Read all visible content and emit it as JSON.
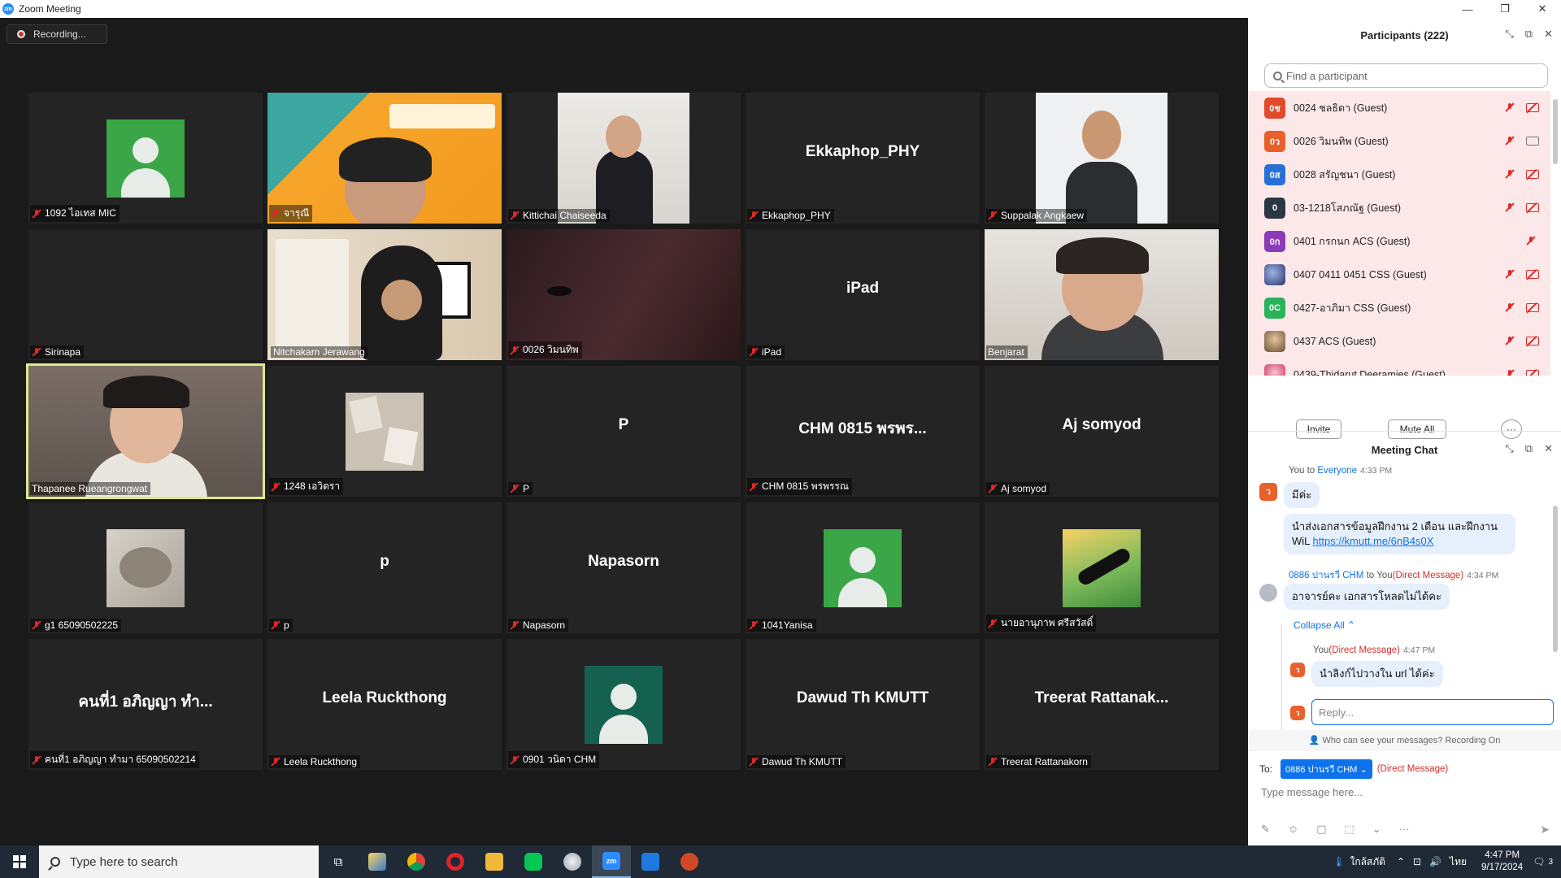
{
  "window": {
    "title": "Zoom Meeting",
    "controls": [
      "—",
      "❐",
      "✕"
    ]
  },
  "recording": {
    "label": "Recording..."
  },
  "tiles": [
    {
      "label": "1092 ไอเทส MIC",
      "big": ""
    },
    {
      "label": "จารุณี",
      "big": ""
    },
    {
      "label": "Kittichai Chaiseeda",
      "big": ""
    },
    {
      "label": "Ekkaphop_PHY",
      "big": "Ekkaphop_PHY"
    },
    {
      "label": "Suppalak Angkaew",
      "big": ""
    },
    {
      "label": "Sirinapa",
      "big": ""
    },
    {
      "label": "Nitchakarn Jerawang",
      "big": ""
    },
    {
      "label": "0026 วิมนทิพ",
      "big": ""
    },
    {
      "label": "iPad",
      "big": "iPad"
    },
    {
      "label": "Benjarat",
      "big": ""
    },
    {
      "label": "Thapanee Rueangrongwat",
      "big": ""
    },
    {
      "label": "1248 เอวิตรา",
      "big": ""
    },
    {
      "label": "P",
      "big": "P"
    },
    {
      "label": "CHM 0815 พรพรรณ",
      "big": "CHM 0815 พรพร..."
    },
    {
      "label": "Aj somyod",
      "big": "Aj somyod"
    },
    {
      "label": "g1 65090502225",
      "big": ""
    },
    {
      "label": "p",
      "big": "p"
    },
    {
      "label": "Napasorn",
      "big": "Napasorn"
    },
    {
      "label": "1041Yanisa",
      "big": ""
    },
    {
      "label": "นายอานุภาพ ศรีสวัสดิ์",
      "big": ""
    },
    {
      "label": "คนที่1 อภิญญา ทำมา 65090502214",
      "big": "คนที่1 อภิญญา ทำ..."
    },
    {
      "label": "Leela Ruckthong",
      "big": "Leela Ruckthong"
    },
    {
      "label": "0901 วนิดา CHM",
      "big": ""
    },
    {
      "label": "Dawud Th KMUTT",
      "big": "Dawud Th KMUTT"
    },
    {
      "label": "Treerat Rattanakorn",
      "big": "Treerat Rattanak..."
    }
  ],
  "participants": {
    "title": "Participants (222)",
    "search_placeholder": "Find a participant",
    "list": [
      {
        "initials": "0ช",
        "name": "0024 ชลธิดา (Guest)",
        "color": "#e0492a"
      },
      {
        "initials": "0ว",
        "name": "0026 วิมนทิพ (Guest)",
        "color": "#e8602c"
      },
      {
        "initials": "0ส",
        "name": "0028 สรัญชนา (Guest)",
        "color": "#2a6fd6"
      },
      {
        "initials": "0",
        "name": "03-1218โสภณัฐ (Guest)",
        "color": "#2b3645"
      },
      {
        "initials": "0ก",
        "name": "0401 กรกนก ACS (Guest)",
        "color": "#8a3bb5"
      },
      {
        "initials": "",
        "name": "0407 0411 0451 CSS (Guest)",
        "color": "#3b4a8f"
      },
      {
        "initials": "0C",
        "name": "0427-อาภิมา CSS (Guest)",
        "color": "#2bb35c"
      },
      {
        "initials": "",
        "name": "0437 ACS (Guest)",
        "color": "#b58a5a"
      },
      {
        "initials": "",
        "name": "0439-Thidarut Deeramies (Guest)",
        "color": "#e0356a"
      }
    ],
    "invite": "Invite",
    "mute_all": "Mute All",
    "more": "···"
  },
  "chat": {
    "title": "Meeting Chat",
    "m1_from": "You to ",
    "m1_to": "Everyone",
    "m1_time": "4:33 PM",
    "m1_avatar": "ว",
    "m1_text": "มีค่ะ",
    "m2_text": "นำส่งเอกสารข้อมูลฝึกงาน 2 เดือน และฝึกงาน WiL ",
    "m2_link": "https://kmutt.me/6nB4s0X",
    "m3_from": "0886 ปานรวี CHM",
    "m3_mid": " to You",
    "m3_dm": "(Direct Message)",
    "m3_time": "4:34 PM",
    "m3_text": "อาจารย์คะ เอกสารโหลดไม่ได้คะ",
    "collapse": "Collapse All",
    "m4_from": "You",
    "m4_dm": "(Direct Message)",
    "m4_time": "4:47 PM",
    "m4_text": "นำลิงก์ไปวางใน url ได้ค่ะ",
    "reply_placeholder": "Reply...",
    "who_can_see": "Who can see your messages? Recording On",
    "to_label": "To:",
    "to_chip": "0886 ปานรวี CHM ⌄",
    "to_dm": "(Direct Message)",
    "type_placeholder": "Type message here..."
  },
  "taskbar": {
    "search_placeholder": "Type here to search",
    "tray_lang": "ใกล้สภัติ",
    "tray_ime": "ไทย",
    "time": "4:47 PM",
    "date": "9/17/2024",
    "notif": "3"
  }
}
